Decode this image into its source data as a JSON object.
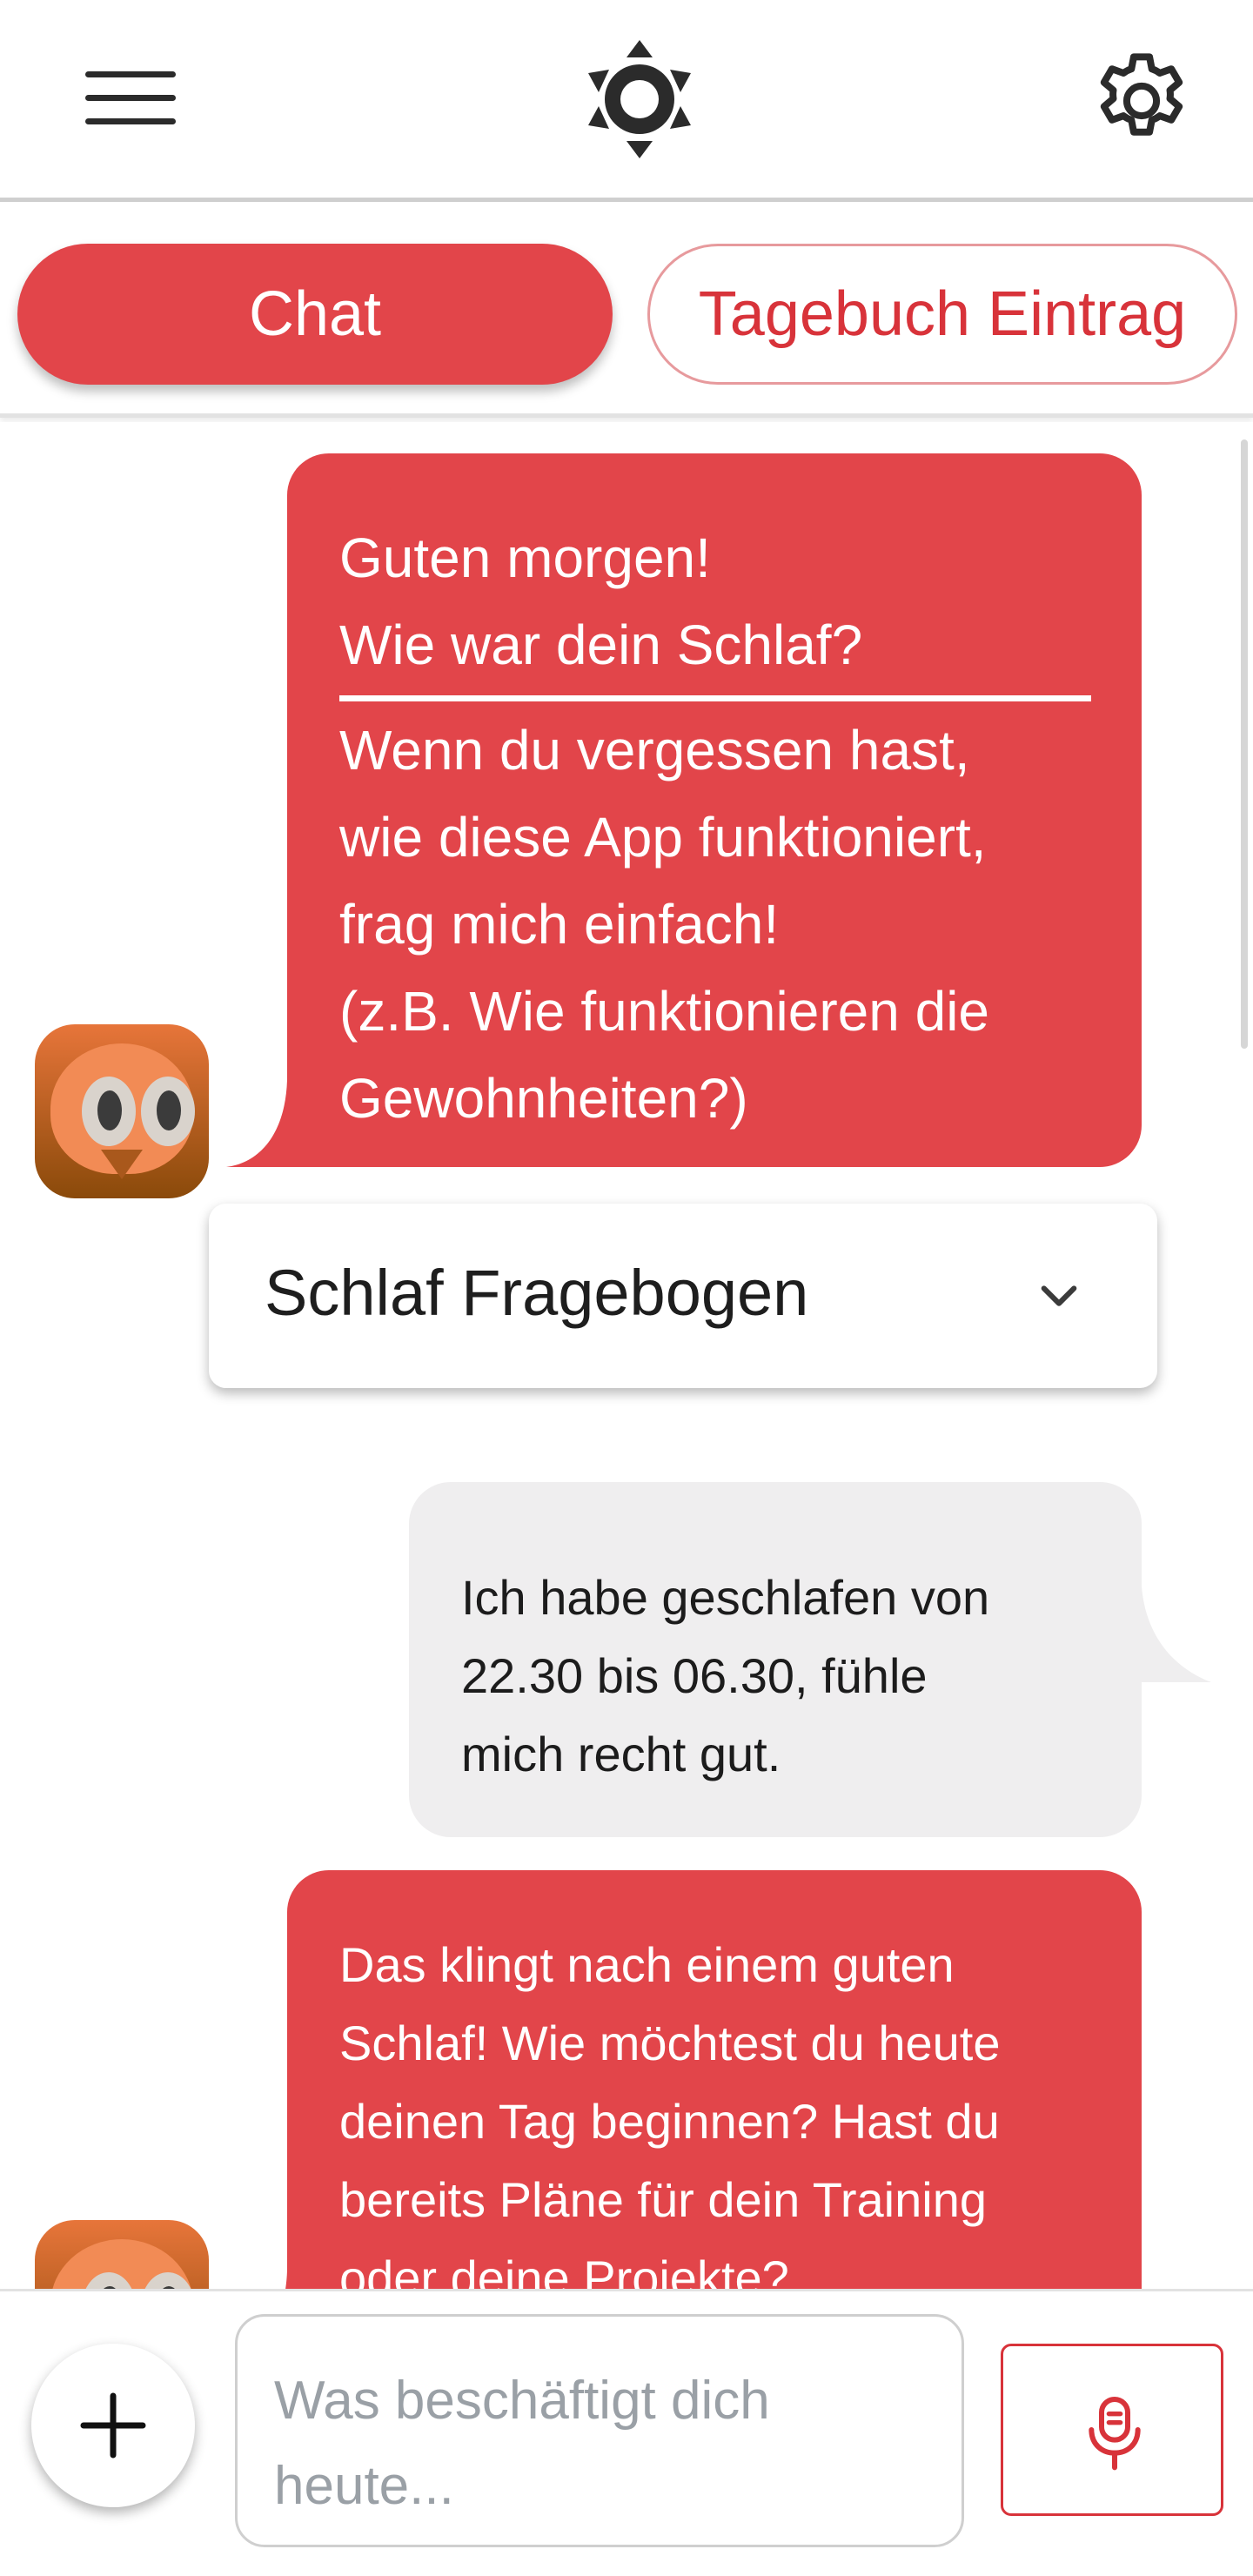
{
  "appbar": {
    "menu_icon": "hamburger-menu-icon",
    "brightness_icon": "brightness-sun-icon",
    "settings_icon": "gear-icon"
  },
  "tabs": [
    {
      "label": "Chat",
      "active": true
    },
    {
      "label": "Tagebuch Eintrag",
      "active": false
    }
  ],
  "messages": [
    {
      "sender": "bot",
      "header_lines": [
        "Guten morgen!",
        "Wie war dein Schlaf?"
      ],
      "lines": [
        "Wenn du vergessen hast,",
        "wie diese App funktioniert,",
        "frag mich einfach!",
        "(z.B. Wie funktionieren die",
        "Gewohnheiten?)"
      ]
    },
    {
      "sender": "user",
      "lines": [
        "Ich habe geschlafen von",
        "22.30 bis 06.30, fühle",
        "mich recht gut."
      ]
    },
    {
      "sender": "bot",
      "lines": [
        "Das klingt nach einem guten",
        "Schlaf! Wie möchtest du heute",
        "deinen Tag beginnen? Hast du",
        "bereits Pläne für dein Training",
        "oder deine Projekte?"
      ]
    }
  ],
  "questionnaire": {
    "label": "Schlaf Fragebogen",
    "icon": "chevron-down-icon"
  },
  "input": {
    "placeholder": "Was beschäftigt dich heute...",
    "value": "",
    "add_icon": "plus-icon",
    "mic_icon": "microphone-icon"
  },
  "colors": {
    "accent": "#e2454a",
    "accent_text": "#d8333a",
    "user_bubble": "#efeeef"
  }
}
